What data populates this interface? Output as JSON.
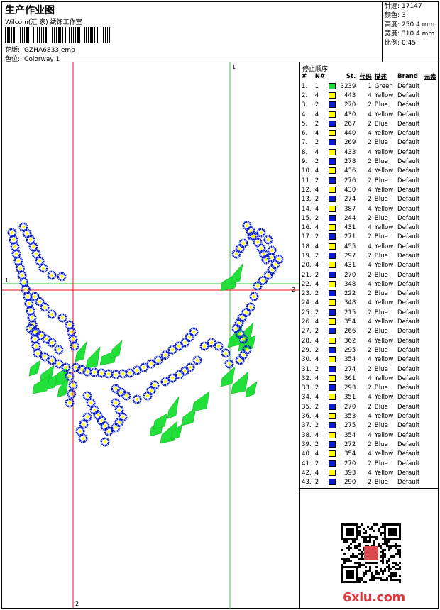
{
  "header": {
    "title": "生产作业图",
    "company": "Wilcom(汇 家) 绣饰工作室",
    "design_label": "花版:",
    "design_file": "GZHA6833.emb",
    "colorway_label": "色位:",
    "colorway_value": "Colorway 1"
  },
  "stats": [
    {
      "label": "针迹:",
      "value": "17147"
    },
    {
      "label": "颜色:",
      "value": "3"
    },
    {
      "label": "高度:",
      "value": "250.4 mm"
    },
    {
      "label": "宽度:",
      "value": "310.4 mm"
    },
    {
      "label": "比例:",
      "value": "0.45"
    }
  ],
  "design": {
    "markers": {
      "top_green": "1",
      "left_green": "1",
      "right_red": "2",
      "bottom_red": "2"
    },
    "colors": {
      "blue": "#0b1ed2",
      "yellow": "#ffff00",
      "green": "#22e03a",
      "guide_red": "#e8161c",
      "guide_green": "#27d23a"
    }
  },
  "stop_sequence": {
    "title": "停止顺序:",
    "headers": {
      "index": "#",
      "needle": "N#",
      "stitches": "St.",
      "code": "代码",
      "desc": "描述",
      "brand": "Brand",
      "element": "元素"
    },
    "rows": [
      {
        "i": "1.",
        "n": "1",
        "color": "green",
        "st": "3239",
        "code": "1",
        "desc": "Green",
        "brand": "Default"
      },
      {
        "i": "2.",
        "n": "4",
        "color": "yellow",
        "st": "443",
        "code": "4",
        "desc": "Yellow",
        "brand": "Default"
      },
      {
        "i": "3.",
        "n": "2",
        "color": "blue",
        "st": "270",
        "code": "2",
        "desc": "Blue",
        "brand": "Default"
      },
      {
        "i": "4.",
        "n": "4",
        "color": "yellow",
        "st": "430",
        "code": "4",
        "desc": "Yellow",
        "brand": "Default"
      },
      {
        "i": "5.",
        "n": "2",
        "color": "blue",
        "st": "267",
        "code": "2",
        "desc": "Blue",
        "brand": "Default"
      },
      {
        "i": "6.",
        "n": "4",
        "color": "yellow",
        "st": "440",
        "code": "4",
        "desc": "Yellow",
        "brand": "Default"
      },
      {
        "i": "7.",
        "n": "2",
        "color": "blue",
        "st": "269",
        "code": "2",
        "desc": "Blue",
        "brand": "Default"
      },
      {
        "i": "8.",
        "n": "4",
        "color": "yellow",
        "st": "433",
        "code": "4",
        "desc": "Yellow",
        "brand": "Default"
      },
      {
        "i": "9.",
        "n": "2",
        "color": "blue",
        "st": "278",
        "code": "2",
        "desc": "Blue",
        "brand": "Default"
      },
      {
        "i": "10.",
        "n": "4",
        "color": "yellow",
        "st": "436",
        "code": "4",
        "desc": "Yellow",
        "brand": "Default"
      },
      {
        "i": "11.",
        "n": "2",
        "color": "blue",
        "st": "276",
        "code": "2",
        "desc": "Blue",
        "brand": "Default"
      },
      {
        "i": "12.",
        "n": "4",
        "color": "yellow",
        "st": "430",
        "code": "4",
        "desc": "Yellow",
        "brand": "Default"
      },
      {
        "i": "13.",
        "n": "2",
        "color": "blue",
        "st": "274",
        "code": "2",
        "desc": "Blue",
        "brand": "Default"
      },
      {
        "i": "14.",
        "n": "4",
        "color": "yellow",
        "st": "387",
        "code": "4",
        "desc": "Yellow",
        "brand": "Default"
      },
      {
        "i": "15.",
        "n": "2",
        "color": "blue",
        "st": "244",
        "code": "2",
        "desc": "Blue",
        "brand": "Default"
      },
      {
        "i": "16.",
        "n": "4",
        "color": "yellow",
        "st": "431",
        "code": "4",
        "desc": "Yellow",
        "brand": "Default"
      },
      {
        "i": "17.",
        "n": "2",
        "color": "blue",
        "st": "271",
        "code": "2",
        "desc": "Blue",
        "brand": "Default"
      },
      {
        "i": "18.",
        "n": "4",
        "color": "yellow",
        "st": "455",
        "code": "4",
        "desc": "Yellow",
        "brand": "Default"
      },
      {
        "i": "19.",
        "n": "2",
        "color": "blue",
        "st": "297",
        "code": "2",
        "desc": "Blue",
        "brand": "Default"
      },
      {
        "i": "20.",
        "n": "4",
        "color": "yellow",
        "st": "431",
        "code": "4",
        "desc": "Yellow",
        "brand": "Default"
      },
      {
        "i": "21.",
        "n": "2",
        "color": "blue",
        "st": "270",
        "code": "2",
        "desc": "Blue",
        "brand": "Default"
      },
      {
        "i": "22.",
        "n": "4",
        "color": "yellow",
        "st": "348",
        "code": "4",
        "desc": "Yellow",
        "brand": "Default"
      },
      {
        "i": "23.",
        "n": "2",
        "color": "blue",
        "st": "222",
        "code": "2",
        "desc": "Blue",
        "brand": "Default"
      },
      {
        "i": "24.",
        "n": "4",
        "color": "yellow",
        "st": "348",
        "code": "4",
        "desc": "Yellow",
        "brand": "Default"
      },
      {
        "i": "25.",
        "n": "2",
        "color": "blue",
        "st": "215",
        "code": "2",
        "desc": "Blue",
        "brand": "Default"
      },
      {
        "i": "26.",
        "n": "4",
        "color": "yellow",
        "st": "354",
        "code": "4",
        "desc": "Yellow",
        "brand": "Default"
      },
      {
        "i": "27.",
        "n": "2",
        "color": "blue",
        "st": "266",
        "code": "2",
        "desc": "Blue",
        "brand": "Default"
      },
      {
        "i": "28.",
        "n": "4",
        "color": "yellow",
        "st": "362",
        "code": "4",
        "desc": "Yellow",
        "brand": "Default"
      },
      {
        "i": "29.",
        "n": "2",
        "color": "blue",
        "st": "295",
        "code": "2",
        "desc": "Blue",
        "brand": "Default"
      },
      {
        "i": "30.",
        "n": "4",
        "color": "yellow",
        "st": "354",
        "code": "4",
        "desc": "Yellow",
        "brand": "Default"
      },
      {
        "i": "31.",
        "n": "2",
        "color": "blue",
        "st": "274",
        "code": "2",
        "desc": "Blue",
        "brand": "Default"
      },
      {
        "i": "32.",
        "n": "4",
        "color": "yellow",
        "st": "361",
        "code": "4",
        "desc": "Yellow",
        "brand": "Default"
      },
      {
        "i": "33.",
        "n": "2",
        "color": "blue",
        "st": "293",
        "code": "2",
        "desc": "Blue",
        "brand": "Default"
      },
      {
        "i": "34.",
        "n": "4",
        "color": "yellow",
        "st": "351",
        "code": "4",
        "desc": "Yellow",
        "brand": "Default"
      },
      {
        "i": "35.",
        "n": "2",
        "color": "blue",
        "st": "270",
        "code": "2",
        "desc": "Blue",
        "brand": "Default"
      },
      {
        "i": "36.",
        "n": "4",
        "color": "yellow",
        "st": "353",
        "code": "4",
        "desc": "Yellow",
        "brand": "Default"
      },
      {
        "i": "37.",
        "n": "2",
        "color": "blue",
        "st": "275",
        "code": "2",
        "desc": "Blue",
        "brand": "Default"
      },
      {
        "i": "38.",
        "n": "4",
        "color": "yellow",
        "st": "354",
        "code": "4",
        "desc": "Yellow",
        "brand": "Default"
      },
      {
        "i": "39.",
        "n": "2",
        "color": "blue",
        "st": "272",
        "code": "2",
        "desc": "Blue",
        "brand": "Default"
      },
      {
        "i": "40.",
        "n": "4",
        "color": "yellow",
        "st": "354",
        "code": "4",
        "desc": "Yellow",
        "brand": "Default"
      },
      {
        "i": "41.",
        "n": "2",
        "color": "blue",
        "st": "270",
        "code": "2",
        "desc": "Blue",
        "brand": "Default"
      },
      {
        "i": "42.",
        "n": "4",
        "color": "yellow",
        "st": "393",
        "code": "4",
        "desc": "Yellow",
        "brand": "Default"
      },
      {
        "i": "43.",
        "n": "2",
        "color": "blue",
        "st": "290",
        "code": "2",
        "desc": "Blue",
        "brand": "Default"
      }
    ]
  },
  "watermark": "6xiu.com",
  "swatch_colors": {
    "green": "#22d83a",
    "yellow": "#ffff00",
    "blue": "#0a1ccf"
  }
}
